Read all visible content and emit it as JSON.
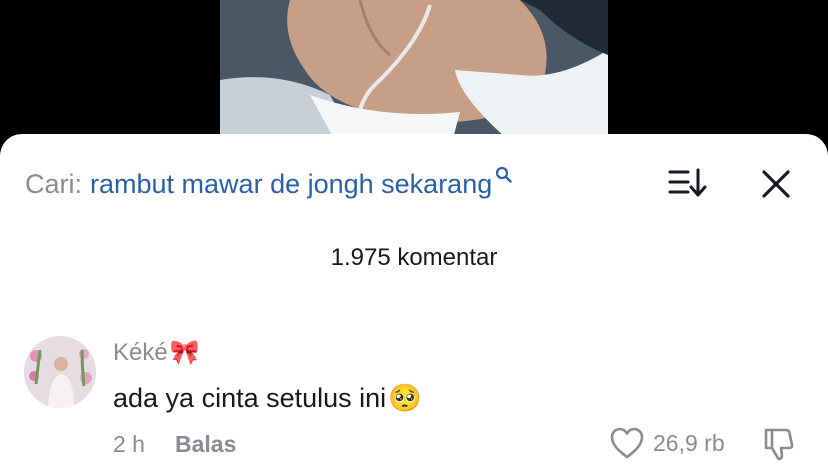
{
  "search": {
    "prefix": "Cari:",
    "query": "rambut mawar de jongh sekarang"
  },
  "comments": {
    "count_label": "1.975 komentar",
    "items": [
      {
        "username": "Kéké",
        "username_emoji": "🎀",
        "text": "ada ya cinta setulus ini",
        "text_emoji": "🥺",
        "time": "2 h",
        "reply_label": "Balas",
        "likes": "26,9 rb"
      }
    ]
  },
  "colors": {
    "search_query": "#2b5fa8",
    "secondary_text": "#8a8b91",
    "primary_text": "#161823"
  },
  "icons": [
    "search-icon",
    "sort-icon",
    "close-icon",
    "heart-icon",
    "dislike-icon"
  ]
}
